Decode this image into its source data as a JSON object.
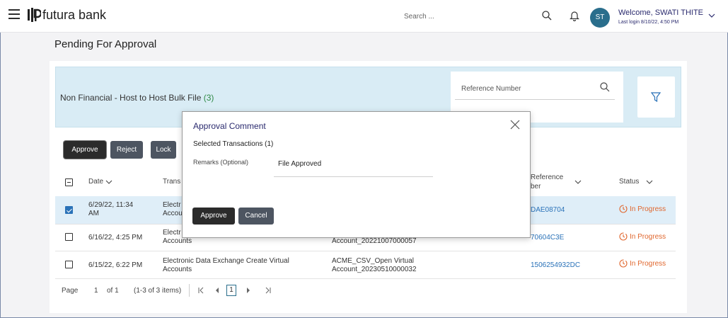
{
  "header": {
    "brand": "futura bank",
    "search_placeholder": "Search ...",
    "avatar_initials": "ST",
    "welcome": "Welcome, SWATI THITE",
    "last_login": "Last login 8/10/22, 4:50 PM"
  },
  "page": {
    "title": "Pending For Approval"
  },
  "banner": {
    "title": "Non Financial - Host to Host Bulk File",
    "count": "(3)",
    "reference_label": "Reference Number"
  },
  "actions": {
    "approve": "Approve",
    "reject": "Reject",
    "lock": "Lock"
  },
  "table": {
    "headers": {
      "date": "Date",
      "transaction": "Trans",
      "reference_1": "Reference",
      "reference_2": "ber",
      "status": "Status"
    },
    "rows": [
      {
        "date_1": "6/29/22, 11:34",
        "date_2": "AM",
        "txn_1": "Electr",
        "txn_2": "Accou",
        "ref": "DAE08704",
        "status": "In Progress",
        "checked": true
      },
      {
        "date_1": "6/16/22, 4:25 PM",
        "txn_1": "Electr",
        "txn_2": "Accounts",
        "file_2": "Account_20221007000057",
        "ref": "70604C3E",
        "status": "In Progress",
        "checked": false
      },
      {
        "date_1": "6/15/22, 6:22 PM",
        "txn_1": "Electronic Data Exchange Create Virtual",
        "txn_2": "Accounts",
        "file_1": "ACME_CSV_Open Virtual",
        "file_2": "Account_20230510000032",
        "ref": "1506254932DC",
        "status": "In Progress",
        "checked": false
      }
    ]
  },
  "pager": {
    "page_label": "Page",
    "page": "1",
    "of": "of 1",
    "items": "(1-3 of 3 items)",
    "current": "1"
  },
  "modal": {
    "title": "Approval Comment",
    "selected": "Selected Transactions (1)",
    "remarks_label": "Remarks (Optional)",
    "remarks_value": "File Approved",
    "approve": "Approve",
    "cancel": "Cancel"
  },
  "colors": {
    "brand_blue": "#2a6e8c",
    "status_orange": "#e0672e",
    "link_blue": "#2a72b8",
    "count_green": "#2f8a45"
  }
}
